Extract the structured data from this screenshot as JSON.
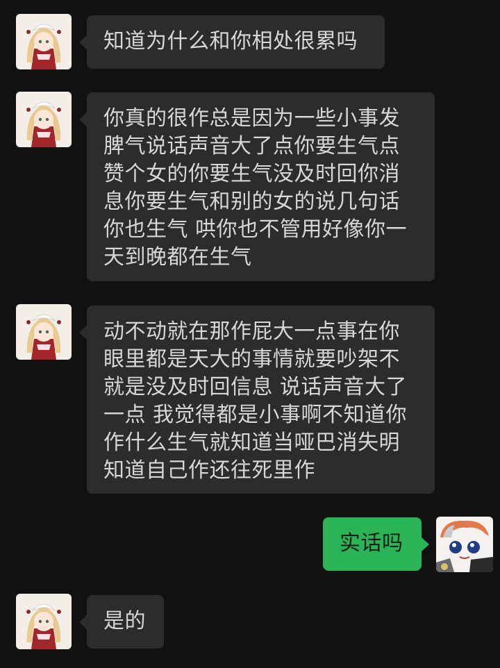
{
  "colors": {
    "background": "#111111",
    "incoming_bubble": "#2c2c2c",
    "outgoing_bubble": "#2bb358",
    "incoming_text": "#d7d7d7",
    "outgoing_text": "#0e2215"
  },
  "contact_avatar_icon": "anime-girl-avatar-icon",
  "self_avatar_icon": "anime-boy-avatar-icon",
  "messages": [
    {
      "side": "in",
      "lines": [
        "知道为什么和你相处很累吗"
      ]
    },
    {
      "side": "in",
      "lines": [
        "你真的很作总是因为一些小事发",
        "脾气说话声音大了点你要生气点",
        "赞个女的你要生气没及时回你消",
        "息你要生气和别的女的说几句话",
        "你也生气 哄你也不管用好像你一",
        "天到晚都在生气"
      ]
    },
    {
      "side": "in",
      "lines": [
        "动不动就在那作屁大一点事在你",
        "眼里都是天大的事情就要吵架不",
        "就是没及时回信息 说话声音大了",
        "一点 我觉得都是小事啊不知道你",
        "作什么生气就知道当哑巴消失明",
        "知道自己作还往死里作"
      ]
    },
    {
      "side": "out",
      "lines": [
        "实话吗"
      ]
    },
    {
      "side": "in",
      "lines": [
        "是的"
      ]
    }
  ]
}
